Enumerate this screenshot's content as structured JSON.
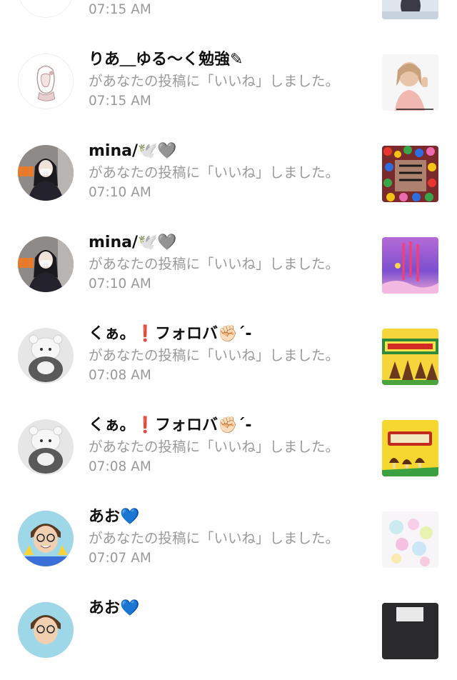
{
  "notifications": [
    {
      "user": "",
      "message": "",
      "time": "07:15 AM",
      "avatar": "sketch-girl-avatar",
      "thumbnail": "girl-photo-thumbnail"
    },
    {
      "user": "りあ＿ゆる〜く勉強✎",
      "message": "があなたの投稿に「いいね」しました。",
      "time": "07:15 AM",
      "avatar": "sketch-girl-avatar",
      "thumbnail": "girl-thumbs-up-photo"
    },
    {
      "user": "mina/🕊️🩶",
      "message": "があなたの投稿に「いいね」しました。",
      "time": "07:10 AM",
      "avatar": "girl-with-mask-avatar",
      "thumbnail": "candy-text-thumbnail"
    },
    {
      "user": "mina/🕊️🩶",
      "message": "があなたの投稿に「いいね」しました。",
      "time": "07:10 AM",
      "avatar": "girl-with-mask-avatar",
      "thumbnail": "purple-poster-thumbnail"
    },
    {
      "user": "くぁ。❗️フォロバ✊🏻´-",
      "message": "があなたの投稿に「いいね」しました。",
      "time": "07:08 AM",
      "avatar": "plush-toy-avatar",
      "thumbnail": "takenoko-no-sato-thumbnail"
    },
    {
      "user": "くぁ。❗️フォロバ✊🏻´-",
      "message": "があなたの投稿に「いいね」しました。",
      "time": "07:08 AM",
      "avatar": "plush-toy-avatar",
      "thumbnail": "kinoko-no-yama-thumbnail"
    },
    {
      "user": "あお💙",
      "message": "があなたの投稿に「いいね」しました。",
      "time": "07:07 AM",
      "avatar": "boy-glasses-avatar",
      "thumbnail": "pastel-collage-thumbnail"
    },
    {
      "user": "あお💙",
      "message": "",
      "time": "",
      "avatar": "boy-glasses-avatar",
      "thumbnail": "dark-photo-thumbnail"
    }
  ]
}
